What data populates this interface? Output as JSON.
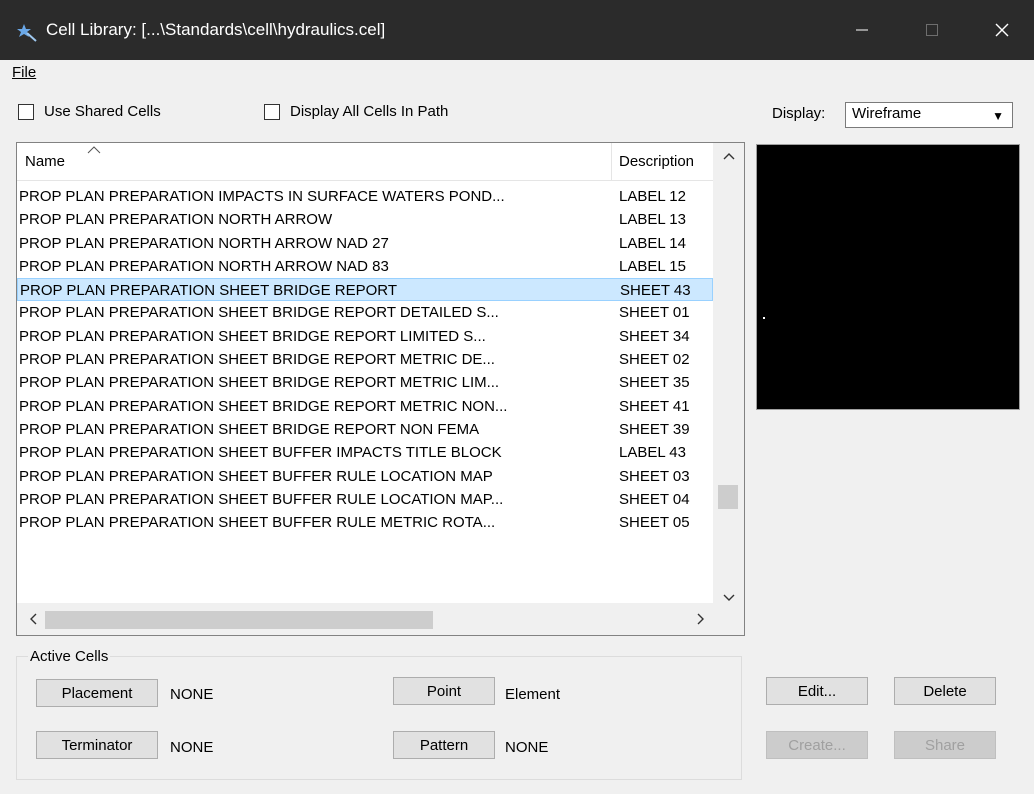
{
  "window": {
    "title": "Cell Library: [...\\Standards\\cell\\hydraulics.cel]",
    "icon": "cell-library-icon"
  },
  "menu": {
    "file_label": "File"
  },
  "options": {
    "use_shared_cells": {
      "label": "Use Shared Cells",
      "checked": false
    },
    "display_all_cells": {
      "label": "Display All Cells In Path",
      "checked": false
    }
  },
  "display": {
    "label": "Display:",
    "value": "Wireframe"
  },
  "table": {
    "columns": {
      "name": "Name",
      "description": "Description"
    },
    "selected_index": 4,
    "rows": [
      {
        "name": "PROP PLAN PREPARATION IMPACTS IN SURFACE WATERS POND...",
        "description": "LABEL 12"
      },
      {
        "name": "PROP PLAN PREPARATION NORTH ARROW",
        "description": "LABEL 13"
      },
      {
        "name": "PROP PLAN PREPARATION NORTH ARROW NAD 27",
        "description": "LABEL 14"
      },
      {
        "name": "PROP PLAN PREPARATION NORTH ARROW NAD 83",
        "description": "LABEL 15"
      },
      {
        "name": "PROP PLAN PREPARATION SHEET BRIDGE REPORT",
        "description": "SHEET 43"
      },
      {
        "name": "PROP PLAN PREPARATION SHEET BRIDGE REPORT DETAILED S...",
        "description": "SHEET 01"
      },
      {
        "name": "PROP PLAN PREPARATION SHEET BRIDGE REPORT LIMITED S...",
        "description": "SHEET 34"
      },
      {
        "name": "PROP PLAN PREPARATION SHEET BRIDGE REPORT METRIC DE...",
        "description": "SHEET 02"
      },
      {
        "name": "PROP PLAN PREPARATION SHEET BRIDGE REPORT METRIC LIM...",
        "description": "SHEET 35"
      },
      {
        "name": "PROP PLAN PREPARATION SHEET BRIDGE REPORT METRIC NON...",
        "description": "SHEET 41"
      },
      {
        "name": "PROP PLAN PREPARATION SHEET BRIDGE REPORT NON FEMA",
        "description": "SHEET 39"
      },
      {
        "name": "PROP PLAN PREPARATION SHEET BUFFER IMPACTS TITLE BLOCK",
        "description": "LABEL 43"
      },
      {
        "name": "PROP PLAN PREPARATION SHEET BUFFER RULE LOCATION MAP",
        "description": "SHEET 03"
      },
      {
        "name": "PROP PLAN PREPARATION SHEET BUFFER RULE LOCATION MAP...",
        "description": "SHEET 04"
      },
      {
        "name": "PROP PLAN PREPARATION SHEET BUFFER RULE METRIC ROTA...",
        "description": "SHEET 05"
      }
    ]
  },
  "active_cells": {
    "group_label": "Active Cells",
    "placement": {
      "label": "Placement",
      "value": "NONE"
    },
    "terminator": {
      "label": "Terminator",
      "value": "NONE"
    },
    "point": {
      "label": "Point",
      "value": "Element"
    },
    "pattern": {
      "label": "Pattern",
      "value": "NONE"
    }
  },
  "actions": {
    "edit": "Edit...",
    "delete": "Delete",
    "create": "Create...",
    "share": "Share"
  },
  "colors": {
    "titlebar": "#2b2b2b",
    "selection": "#cce8ff",
    "preview_bg": "#000000"
  }
}
